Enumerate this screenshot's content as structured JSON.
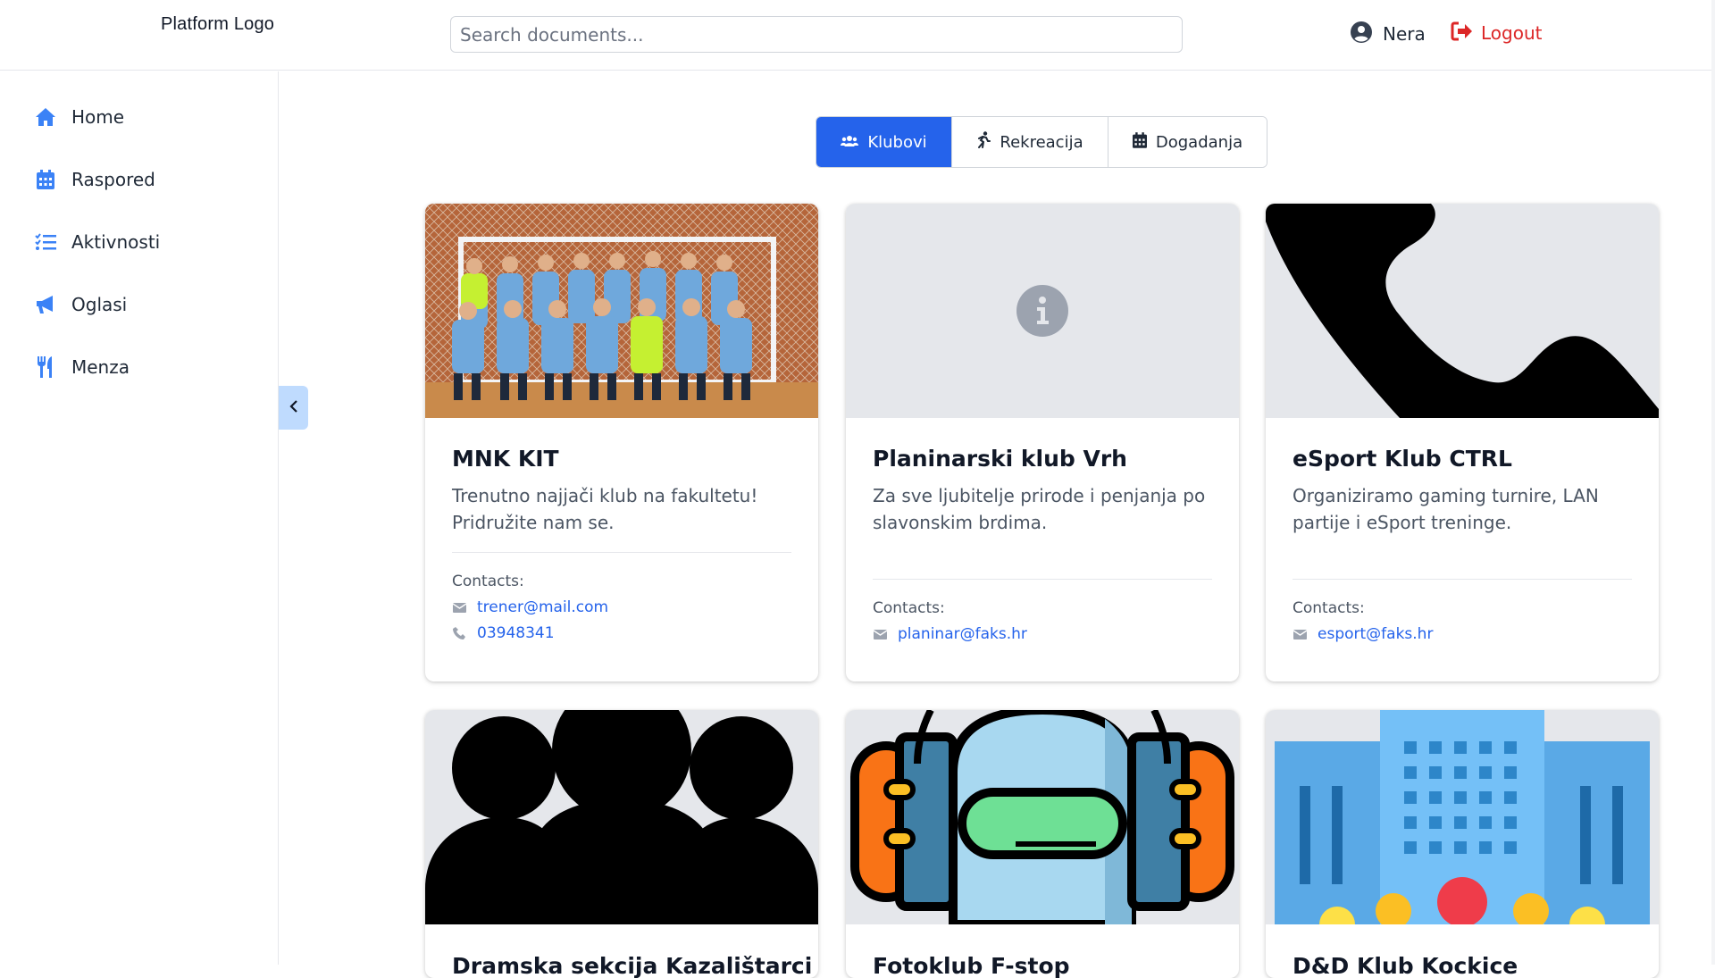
{
  "header": {
    "logo": "Platform Logo",
    "search_placeholder": "Search documents...",
    "user_name": "Nera",
    "logout_label": "Logout"
  },
  "sidebar": {
    "items": [
      {
        "label": "Home",
        "icon": "home-icon"
      },
      {
        "label": "Raspored",
        "icon": "calendar-icon"
      },
      {
        "label": "Aktivnosti",
        "icon": "list-icon"
      },
      {
        "label": "Oglasi",
        "icon": "megaphone-icon"
      },
      {
        "label": "Menza",
        "icon": "utensils-icon"
      }
    ],
    "collapse_icon": "chevron-left-icon"
  },
  "tabs": [
    {
      "label": "Klubovi",
      "icon": "users-icon",
      "active": true
    },
    {
      "label": "Rekreacija",
      "icon": "running-icon",
      "active": false
    },
    {
      "label": "Dogadanja",
      "icon": "calendar-icon",
      "active": false
    }
  ],
  "cards": [
    {
      "title": "MNK KIT",
      "description": "Trenutno najjači klub na fakultetu! Pridružite nam se.",
      "contacts_label": "Contacts:",
      "email": "trener@mail.com",
      "phone": "03948341",
      "image": "team-photo"
    },
    {
      "title": "Planinarski klub Vrh",
      "description": "Za sve ljubitelje prirode i penjanja po slavonskim brdima.",
      "contacts_label": "Contacts:",
      "email": "planinar@faks.hr",
      "image": "info-icon-placeholder"
    },
    {
      "title": "eSport Klub CTRL",
      "description": "Organiziramo gaming turnire, LAN partije i eSport treninge.",
      "contacts_label": "Contacts:",
      "email": "esport@faks.hr",
      "image": "phone-icon"
    },
    {
      "title": "Dramska sekcija Kazalištarci",
      "image": "group-icon"
    },
    {
      "title": "Fotoklub F-stop",
      "image": "vr-headset-icon"
    },
    {
      "title": "D&D Klub Kockice",
      "image": "building-icon"
    }
  ],
  "colors": {
    "primary": "#2563eb",
    "logout": "#dc2626",
    "sidebar_icon": "#3b82f6",
    "collapse_bg": "#bfdbfe"
  }
}
